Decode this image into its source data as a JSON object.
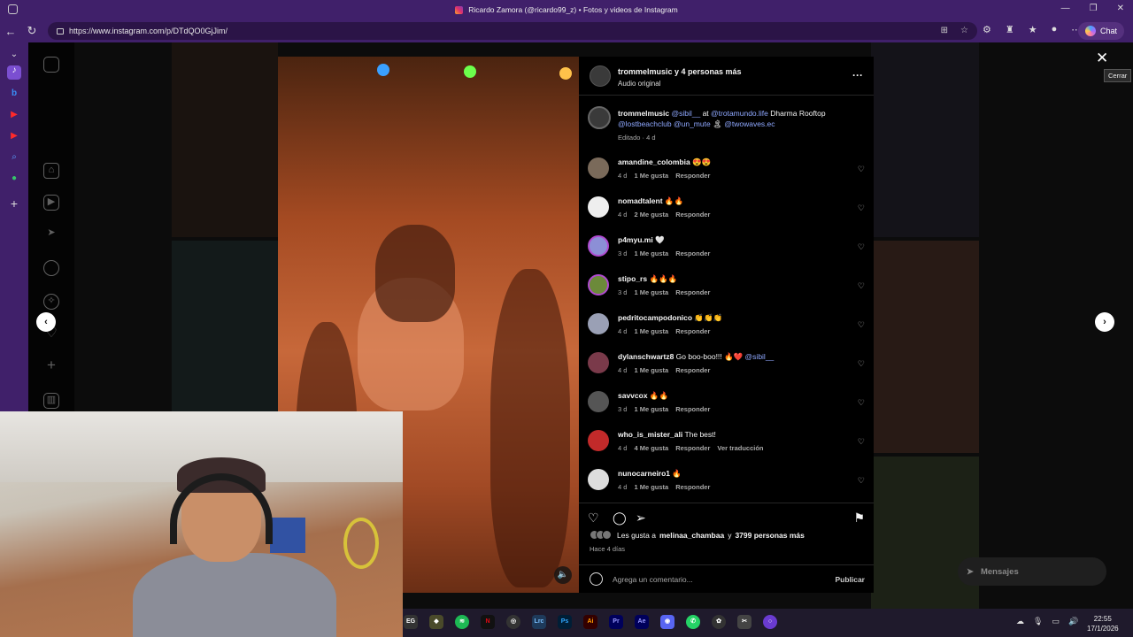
{
  "browser": {
    "window_title": "Ricardo Zamora (@ricardo99_z) • Fotos y videos de Instagram",
    "url": "https://www.instagram.com/p/DTdQO0GjJim/",
    "chat_label": "Chat"
  },
  "post": {
    "header_name": "trommelmusic y 4 personas más",
    "header_sub": "Audio original",
    "more_icon": "more-horizontal-icon",
    "caption": {
      "user": "trommelmusic",
      "m1": "@sibil__",
      "at": " at ",
      "m2": "@trotamundo.life",
      "text": " Dharma Rooftop ",
      "m3": "@lostbeachclub",
      "m4": "@un_mute",
      "text2": " 🏝 ",
      "m5": "@twowaves.ec",
      "meta": "Editado · 4 d"
    },
    "comments": [
      {
        "user": "amandine_colombia",
        "text": " 😍😍",
        "time": "4 d",
        "likes": "1 Me gusta",
        "reply": "Responder",
        "extra": ""
      },
      {
        "user": "nomadtalent",
        "text": " 🔥🔥",
        "time": "4 d",
        "likes": "2 Me gusta",
        "reply": "Responder",
        "extra": ""
      },
      {
        "user": "p4myu.mi",
        "text": " 🤍",
        "time": "3 d",
        "likes": "1 Me gusta",
        "reply": "Responder",
        "extra": ""
      },
      {
        "user": "stipo_rs",
        "text": " 🔥🔥🔥",
        "time": "3 d",
        "likes": "1 Me gusta",
        "reply": "Responder",
        "extra": ""
      },
      {
        "user": "pedritocampodonico",
        "text": " 👏👏👏",
        "time": "4 d",
        "likes": "1 Me gusta",
        "reply": "Responder",
        "extra": ""
      },
      {
        "user": "dylanschwartz8",
        "text": " Go boo-boo!!! 🔥❤️ ",
        "mention": "@sibil__",
        "time": "4 d",
        "likes": "1 Me gusta",
        "reply": "Responder",
        "extra": ""
      },
      {
        "user": "savvcox",
        "text": " 🔥🔥",
        "time": "3 d",
        "likes": "1 Me gusta",
        "reply": "Responder",
        "extra": ""
      },
      {
        "user": "who_is_mister_ali",
        "text": " The best!",
        "time": "4 d",
        "likes": "4 Me gusta",
        "reply": "Responder",
        "extra": "Ver traducción"
      },
      {
        "user": "nunocarneiro1",
        "text": " 🔥",
        "time": "4 d",
        "likes": "1 Me gusta",
        "reply": "Responder",
        "extra": ""
      }
    ],
    "likes_prefix": "Les gusta a ",
    "likes_user": "melinaa_chambaa",
    "likes_suffix": " y ",
    "likes_count": "3799 personas más",
    "time_ago": "Hace 4 días",
    "comment_placeholder": "Agrega un comentario...",
    "publish_label": "Publicar"
  },
  "overlay": {
    "close_tooltip": "Cerrar",
    "messages_label": "Mensajes"
  },
  "taskbar": {
    "time": "22:55",
    "date": "17/1/2026"
  }
}
